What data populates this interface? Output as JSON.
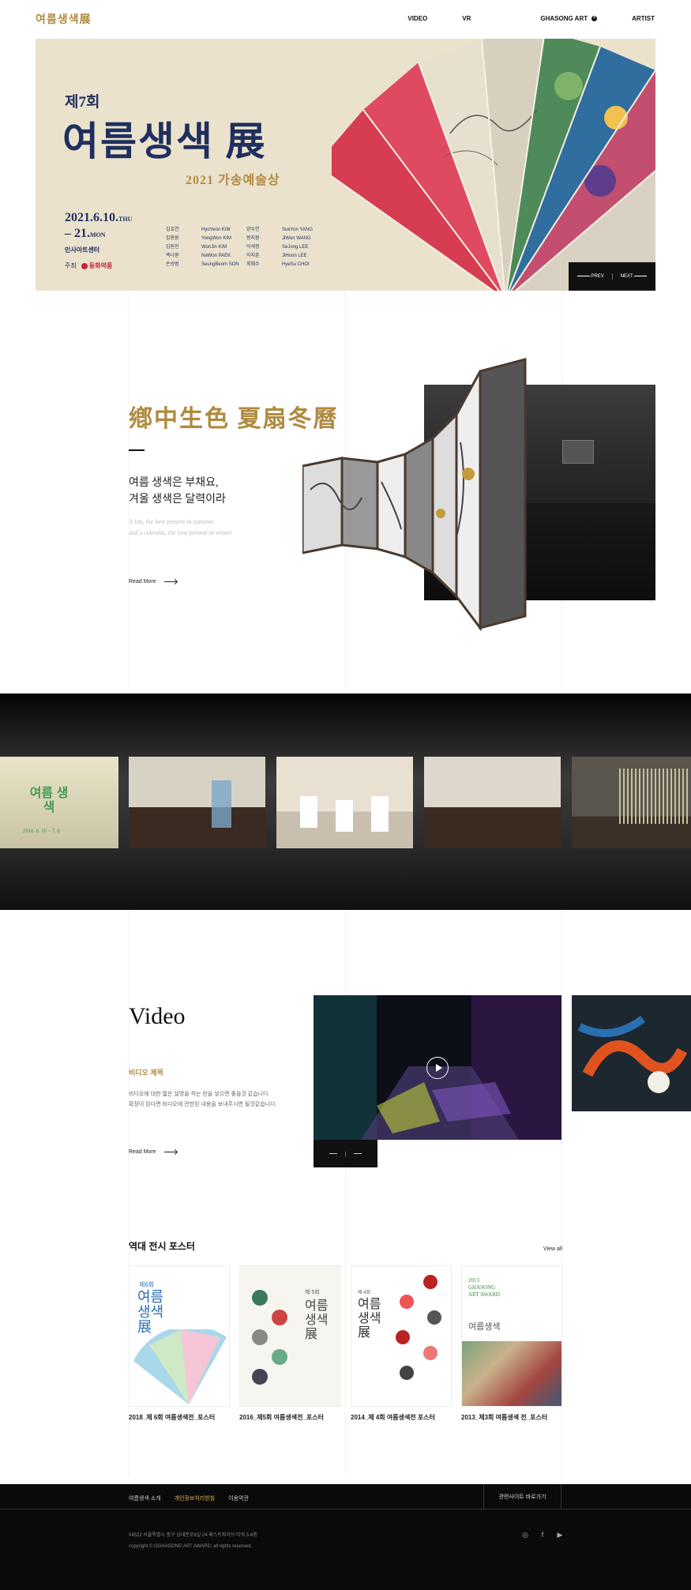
{
  "header": {
    "logo": "여름생색展",
    "nav": [
      {
        "label": "VIDEO"
      },
      {
        "label": "VR"
      },
      {
        "label": "GHASONG ART",
        "icon": "plus-circle-icon"
      },
      {
        "label": "ARTIST"
      }
    ]
  },
  "hero": {
    "edition": "제7회",
    "title": "여름생색 展",
    "subtitle": "2021 가송예술상",
    "date_start": "2021.6.10.",
    "date_start_day": "THU",
    "date_end": "– 21.",
    "date_end_day": "MON",
    "venue": "인사아트센터",
    "host_label": "주최",
    "host_name": "동화약품",
    "artists": [
      [
        "김효연",
        "HyoYeon KIM",
        "양수연",
        "SueYon YANG"
      ],
      [
        "김용원",
        "YongWon KIM",
        "왕지원",
        "JiWon WANG"
      ],
      [
        "김원진",
        "WonJin KIM",
        "이세정",
        "SeJung LEE"
      ],
      [
        "백나원",
        "NaWon PAEK",
        "이지훈",
        "JiHoon LEE"
      ],
      [
        "손승범",
        "SeungBeom SON",
        "최혜수",
        "HyeSu CHOI"
      ]
    ],
    "prev_label": "PREV",
    "next_label": "NEXT"
  },
  "intro": {
    "title": "鄕中生色  夏扇冬曆",
    "ko_line1": "여름 생색은 부채요,",
    "ko_line2": "겨울 생색은 달력이라",
    "en_line1": "A fan, the best present in summer,",
    "en_line2": "and a calendar, the best present in winter",
    "read_more": "Read More"
  },
  "gallery": {
    "thumb_text": "여름 생색",
    "thumb_date": "2016. 6. 20 ~ 7. 6"
  },
  "video": {
    "title": "Video",
    "subtitle": "비디오 제목",
    "desc_line1": "비디오에 대한 짧은 설명을 적는 란을 넣으면 좋을것 같습니다.",
    "desc_line2": "확장이 된다면 비디오에 관한된 내용을 보내주시면 될것같습니다.",
    "read_more": "Read More"
  },
  "posters": {
    "title": "역대 전시 포스터",
    "view_all": "View all",
    "items": [
      {
        "caption": "2018_제 6회 여름생색전_포스터",
        "text": "여름 생색 展",
        "edition": "제6회"
      },
      {
        "caption": "2016_제5회 여름생색전_포스터",
        "text": "여름 생색 展",
        "edition": "제 5회"
      },
      {
        "caption": "2014_제 4회 여름생색전 포스터",
        "text": "여름 생색 展",
        "edition": "제 4회"
      },
      {
        "caption": "2013_제3회 여름생색 전_포스터",
        "text": "여름생색",
        "edition": "2013 GHASONG ART AWARD"
      }
    ]
  },
  "footer": {
    "links": [
      "여름생색 소개",
      "개인정보처리방침",
      "이용약관"
    ],
    "family_site": "관련사이트 바로가기",
    "address": "04522 서울특별시 중구 남대문로9길 24 패스트파이브 타워 5-6층",
    "copyright": "copyright © GGHASONG ART AWARD. all rights reserved.",
    "social": [
      "instagram-icon",
      "facebook-icon",
      "youtube-icon"
    ]
  },
  "colors": {
    "gold": "#b08a3e",
    "navy": "#1f2f5e",
    "hero_bg": "#ebe2ce"
  }
}
